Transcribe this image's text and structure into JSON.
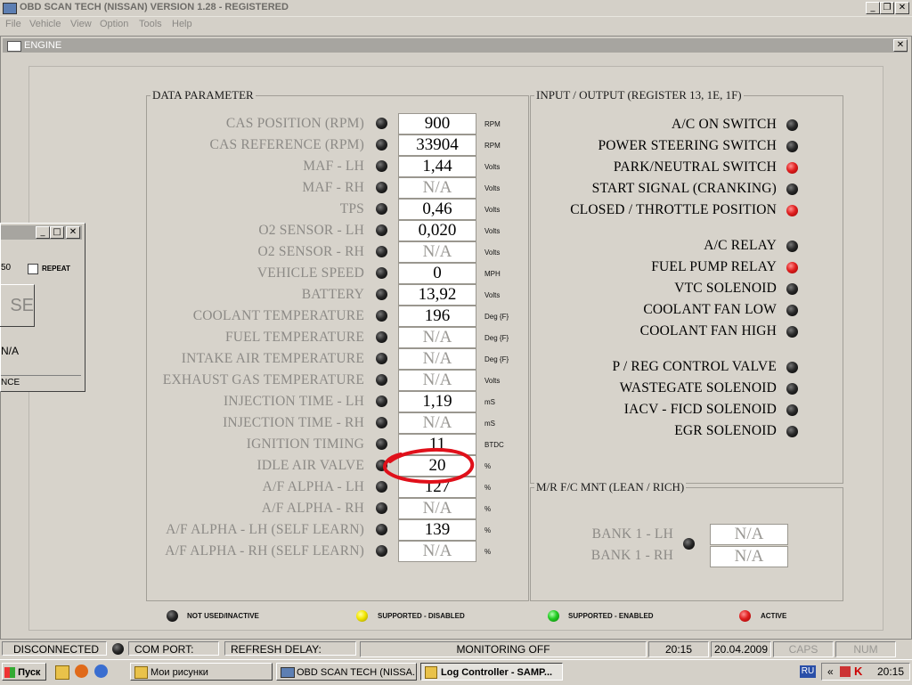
{
  "app": {
    "title": "OBD SCAN TECH (NISSAN) VERSION 1.28 - REGISTERED"
  },
  "menu": [
    "File",
    "Vehicle",
    "View",
    "Option",
    "Tools",
    "Help"
  ],
  "engine_window": {
    "title": "ENGINE"
  },
  "data_parameter": {
    "title": "DATA PARAMETER",
    "rows": [
      {
        "label": "CAS POSITION (RPM)",
        "value": "900",
        "unit": "RPM",
        "na": false
      },
      {
        "label": "CAS REFERENCE (RPM)",
        "value": "33904",
        "unit": "RPM",
        "na": false
      },
      {
        "label": "MAF - LH",
        "value": "1,44",
        "unit": "Volts",
        "na": false
      },
      {
        "label": "MAF - RH",
        "value": "N/A",
        "unit": "Volts",
        "na": true
      },
      {
        "label": "TPS",
        "value": "0,46",
        "unit": "Volts",
        "na": false
      },
      {
        "label": "O2 SENSOR - LH",
        "value": "0,020",
        "unit": "Volts",
        "na": false
      },
      {
        "label": "O2 SENSOR - RH",
        "value": "N/A",
        "unit": "Volts",
        "na": true
      },
      {
        "label": "VEHICLE SPEED",
        "value": "0",
        "unit": "MPH",
        "na": false
      },
      {
        "label": "BATTERY",
        "value": "13,92",
        "unit": "Volts",
        "na": false
      },
      {
        "label": "COOLANT TEMPERATURE",
        "value": "196",
        "unit": "Deg {F}",
        "na": false
      },
      {
        "label": "FUEL TEMPERATURE",
        "value": "N/A",
        "unit": "Deg {F}",
        "na": true
      },
      {
        "label": "INTAKE AIR TEMPERATURE",
        "value": "N/A",
        "unit": "Deg {F}",
        "na": true
      },
      {
        "label": "EXHAUST GAS TEMPERATURE",
        "value": "N/A",
        "unit": "Volts",
        "na": true
      },
      {
        "label": "INJECTION TIME - LH",
        "value": "1,19",
        "unit": "mS",
        "na": false
      },
      {
        "label": "INJECTION TIME - RH",
        "value": "N/A",
        "unit": "mS",
        "na": true
      },
      {
        "label": "IGNITION TIMING",
        "value": "11",
        "unit": "BTDC",
        "na": false
      },
      {
        "label": "IDLE AIR VALVE",
        "value": "20",
        "unit": "%",
        "na": false
      },
      {
        "label": "A/F ALPHA - LH",
        "value": "127",
        "unit": "%",
        "na": false
      },
      {
        "label": "A/F ALPHA - RH",
        "value": "N/A",
        "unit": "%",
        "na": true
      },
      {
        "label": "A/F ALPHA - LH (SELF LEARN)",
        "value": "139",
        "unit": "%",
        "na": false
      },
      {
        "label": "A/F ALPHA - RH (SELF LEARN)",
        "value": "N/A",
        "unit": "%",
        "na": true
      }
    ]
  },
  "io": {
    "title": "INPUT / OUTPUT (REGISTER 13, 1E, 1F)",
    "items": [
      {
        "label": "A/C ON SWITCH",
        "state": "inactive"
      },
      {
        "label": "POWER STEERING SWITCH",
        "state": "inactive"
      },
      {
        "label": "PARK/NEUTRAL SWITCH",
        "state": "active"
      },
      {
        "label": "START SIGNAL (CRANKING)",
        "state": "inactive"
      },
      {
        "label": "CLOSED / THROTTLE POSITION",
        "state": "active"
      },
      {
        "label": "A/C RELAY",
        "state": "inactive"
      },
      {
        "label": "FUEL PUMP RELAY",
        "state": "active"
      },
      {
        "label": "VTC SOLENOID",
        "state": "inactive"
      },
      {
        "label": "COOLANT FAN LOW",
        "state": "inactive"
      },
      {
        "label": "COOLANT FAN HIGH",
        "state": "inactive"
      },
      {
        "label": "P / REG CONTROL VALVE",
        "state": "inactive"
      },
      {
        "label": "WASTEGATE SOLENOID",
        "state": "inactive"
      },
      {
        "label": "IACV - FICD SOLENOID",
        "state": "inactive"
      },
      {
        "label": "EGR SOLENOID",
        "state": "inactive"
      }
    ]
  },
  "mr_fc": {
    "title": "M/R F/C MNT (LEAN / RICH)",
    "rows": [
      {
        "label": "BANK 1 - LH",
        "value": "N/A"
      },
      {
        "label": "BANK 1 - RH",
        "value": "N/A"
      }
    ]
  },
  "legend": [
    {
      "label": "NOT USED/INACTIVE",
      "color": "#000000"
    },
    {
      "label": "SUPPORTED - DISABLED",
      "color": "#f2e600"
    },
    {
      "label": "SUPPORTED - ENABLED",
      "color": "#22cc22"
    },
    {
      "label": "ACTIVE",
      "color": "#e02020"
    }
  ],
  "annotation": {
    "color": "#e0101a"
  },
  "small_dialog": {
    "num": "50",
    "repeat_label": "REPEAT",
    "button": "SE",
    "value": "N/A",
    "footer": "NCE"
  },
  "status": {
    "connection": "DISCONNECTED",
    "com_port": "COM PORT:",
    "refresh": "REFRESH DELAY:",
    "monitoring": "MONITORING OFF",
    "time": "20:15",
    "date": "20.04.2009",
    "caps": "CAPS",
    "num": "NUM"
  },
  "taskbar": {
    "start": "Пуск",
    "tasks": [
      "Мои рисунки",
      "OBD SCAN TECH (NISSA...",
      "Log Controller - SAMP..."
    ],
    "lang": "RU",
    "clock": "20:15"
  }
}
